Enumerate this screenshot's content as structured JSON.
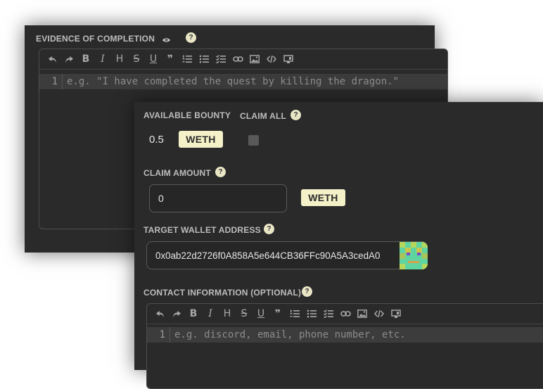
{
  "evidence": {
    "label": "EVIDENCE OF COMPLETION",
    "line_number": "1",
    "placeholder": "e.g. \"I have completed the quest by killing the dragon.\""
  },
  "bounty": {
    "available_label": "AVAILABLE BOUNTY",
    "claim_all_label": "CLAIM ALL",
    "amount": "0.5",
    "token": "WETH",
    "claim_all_checked": false
  },
  "claim": {
    "label": "CLAIM AMOUNT",
    "value": "0",
    "token": "WETH"
  },
  "wallet": {
    "label": "TARGET WALLET ADDRESS",
    "address": "0x0ab22d2726f0A858A5e644CB36FFc90A5A3cedA0"
  },
  "contact": {
    "label": "CONTACT INFORMATION (OPTIONAL)",
    "line_number": "1",
    "placeholder": "e.g. discord, email, phone number, etc."
  },
  "help_glyph": "?",
  "toolbar": {
    "icons": [
      "undo-icon",
      "redo-icon",
      "bold-icon",
      "italic-icon",
      "heading-icon",
      "strikethrough-icon",
      "underline-icon",
      "quote-icon",
      "ordered-list-icon",
      "unordered-list-icon",
      "checklist-icon",
      "link-icon",
      "image-icon",
      "code-icon",
      "preview-icon"
    ],
    "glyphs": {
      "bold": "B",
      "italic": "I",
      "heading": "H",
      "strikethrough": "S",
      "underline": "U",
      "quote": "❞"
    }
  }
}
